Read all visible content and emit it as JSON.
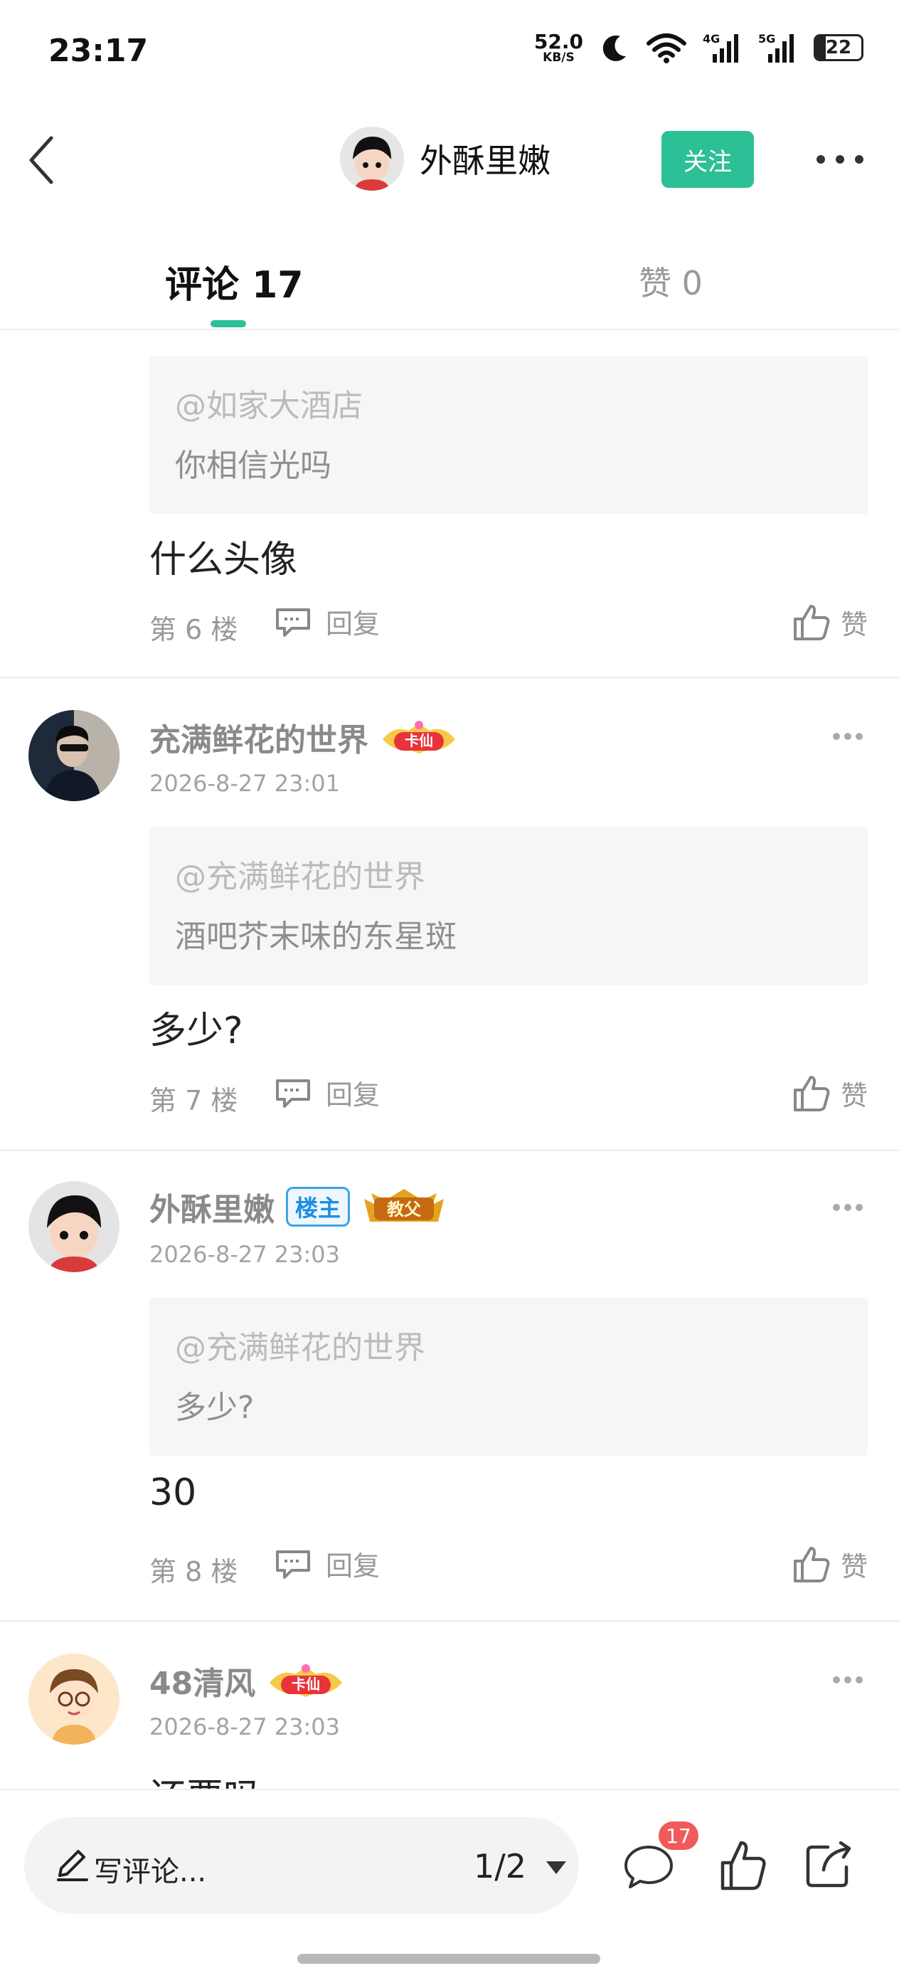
{
  "status_bar": {
    "time": "23:17",
    "net_speed": "52.0",
    "net_unit": "KB/S",
    "net_4g": "4G",
    "net_5g": "5G",
    "battery": "22"
  },
  "header": {
    "author_name": "外酥里嫩",
    "follow_label": "关注"
  },
  "tabs": {
    "comments_label": "评论 17",
    "likes_label": "赞 0"
  },
  "comments": [
    {
      "quote_user": "@如家大酒店",
      "quote_text": "你相信光吗",
      "text": "什么头像",
      "floor": "第 6 楼",
      "reply_label": "回复",
      "like_label": "赞"
    },
    {
      "name": "充满鲜花的世界",
      "badge": "卡仙",
      "time": "2026-8-27 23:01",
      "quote_user": "@充满鲜花的世界",
      "quote_text": "酒吧芥末味的东星斑",
      "text": "多少?",
      "floor": "第 7 楼",
      "reply_label": "回复",
      "like_label": "赞"
    },
    {
      "name": "外酥里嫩",
      "owner_badge": "楼主",
      "badge": "教父",
      "time": "2026-8-27 23:03",
      "quote_user": "@充满鲜花的世界",
      "quote_text": "多少?",
      "text": "30",
      "floor": "第 8 楼",
      "reply_label": "回复",
      "like_label": "赞"
    },
    {
      "name": "48清风",
      "badge": "卡仙",
      "time": "2026-8-27 23:03",
      "text": "还要吗"
    }
  ],
  "bottom_bar": {
    "write_placeholder": "写评论...",
    "page_indicator": "1/2",
    "comment_count": "17"
  },
  "colors": {
    "accent": "#2dbf95",
    "count_badge": "#f05a5a"
  }
}
